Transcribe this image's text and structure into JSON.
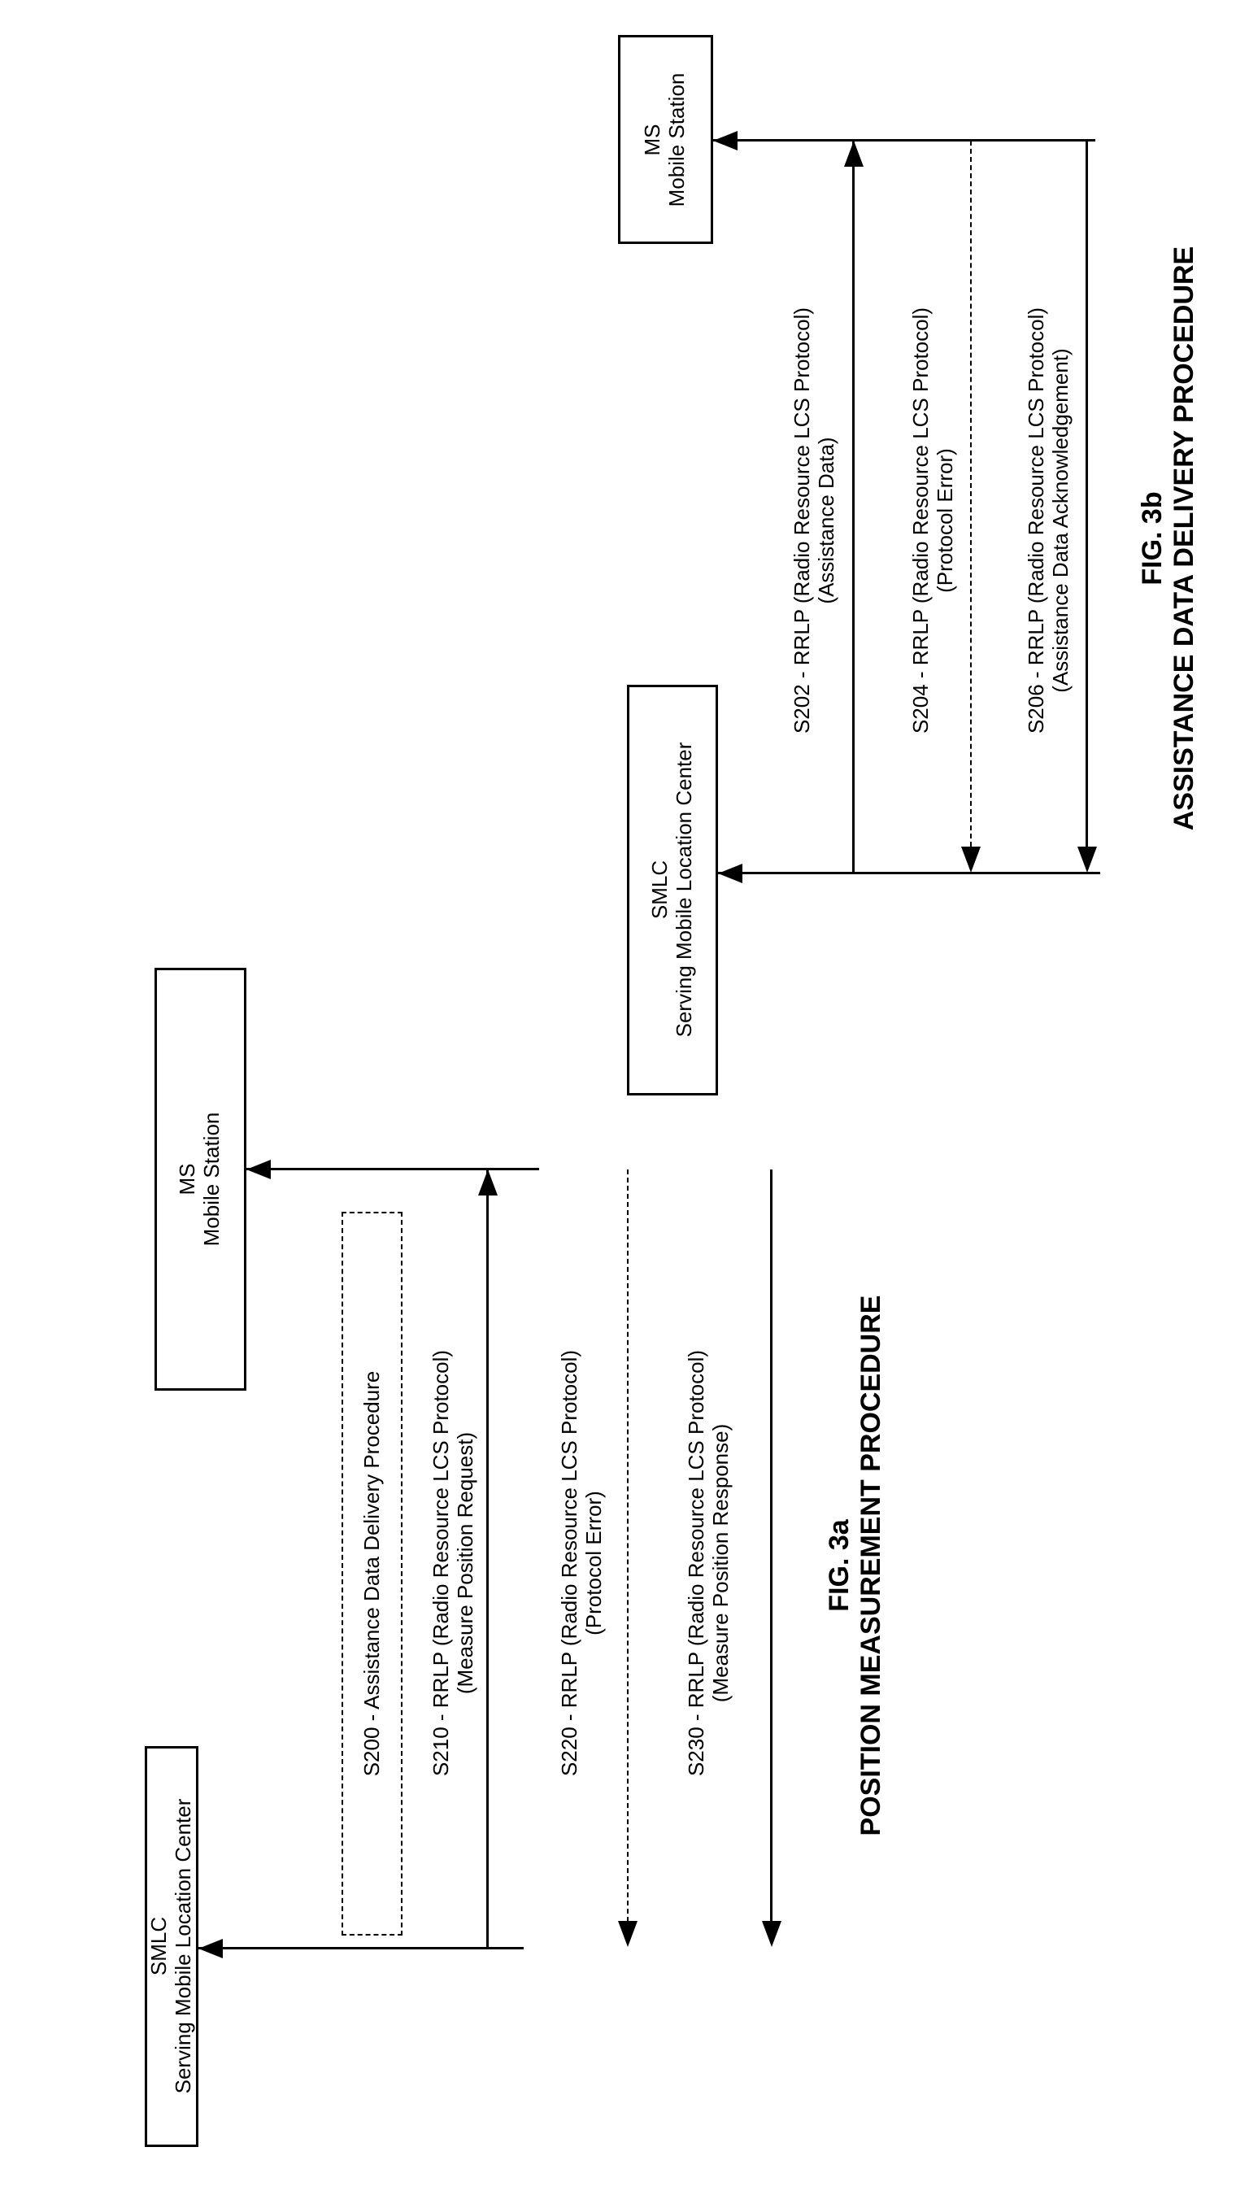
{
  "figures": [
    {
      "id": "fig3a",
      "figure_label": "FIG. 3a",
      "title": "POSITION MEASUREMENT PROCEDURE",
      "entities": {
        "smlc": {
          "short": "SMLC",
          "long": "Serving Mobile Location Center"
        },
        "ms": {
          "short": "MS",
          "long": "Mobile Station"
        }
      },
      "procedure_box": {
        "label": "S200 - Assistance Data Delivery Procedure",
        "style": "dashed"
      },
      "messages": [
        {
          "step": "S210",
          "line1": "S210 - RRLP (Radio Resource LCS Protocol)",
          "line2": "(Measure Position Request)",
          "from": "SMLC",
          "to": "MS",
          "style": "solid"
        },
        {
          "step": "S220",
          "line1": "S220 - RRLP (Radio Resource LCS Protocol)",
          "line2": "(Protocol Error)",
          "from": "MS",
          "to": "SMLC",
          "style": "dashed"
        },
        {
          "step": "S230",
          "line1": "S230 - RRLP (Radio Resource LCS Protocol)",
          "line2": "(Measure Position Response)",
          "from": "MS",
          "to": "SMLC",
          "style": "solid"
        }
      ]
    },
    {
      "id": "fig3b",
      "figure_label": "FIG. 3b",
      "title": "ASSISTANCE DATA DELIVERY PROCEDURE",
      "entities": {
        "smlc": {
          "short": "SMLC",
          "long": "Serving Mobile Location Center"
        },
        "ms": {
          "short": "MS",
          "long": "Mobile Station"
        }
      },
      "messages": [
        {
          "step": "S202",
          "line1": "S202 - RRLP (Radio Resource LCS Protocol)",
          "line2": "(Assistance Data)",
          "from": "SMLC",
          "to": "MS",
          "style": "solid"
        },
        {
          "step": "S204",
          "line1": "S204 - RRLP (Radio Resource LCS Protocol)",
          "line2": "(Protocol Error)",
          "from": "MS",
          "to": "SMLC",
          "style": "dashed"
        },
        {
          "step": "S206",
          "line1": "S206 - RRLP (Radio Resource LCS Protocol)",
          "line2": "(Assistance Data Acknowledgement)",
          "from": "MS",
          "to": "SMLC",
          "style": "solid"
        }
      ]
    }
  ]
}
